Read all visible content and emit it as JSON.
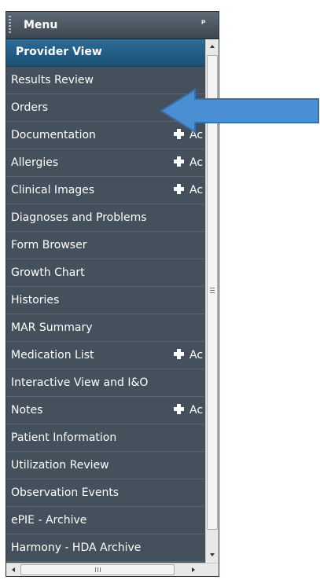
{
  "menu": {
    "title": "Menu",
    "pin_glyph": "ᵖ"
  },
  "section": {
    "label": "Provider View"
  },
  "items": [
    {
      "label": "Results Review",
      "add": ""
    },
    {
      "label": "Orders",
      "add": ""
    },
    {
      "label": "Documentation",
      "add": "Ac"
    },
    {
      "label": "Allergies",
      "add": "Ac"
    },
    {
      "label": "Clinical Images",
      "add": "Ac"
    },
    {
      "label": "Diagnoses and Problems",
      "add": ""
    },
    {
      "label": "Form Browser",
      "add": ""
    },
    {
      "label": "Growth Chart",
      "add": ""
    },
    {
      "label": "Histories",
      "add": ""
    },
    {
      "label": "MAR Summary",
      "add": ""
    },
    {
      "label": "Medication List",
      "add": "Ac"
    },
    {
      "label": "Interactive View and I&O",
      "add": ""
    },
    {
      "label": "Notes",
      "add": "Ac"
    },
    {
      "label": "Patient Information",
      "add": ""
    },
    {
      "label": "Utilization Review",
      "add": ""
    },
    {
      "label": "Observation Events",
      "add": ""
    },
    {
      "label": "ePIE - Archive",
      "add": ""
    },
    {
      "label": "Harmony - HDA Archive",
      "add": ""
    }
  ],
  "colors": {
    "panel_bg": "#44505b",
    "section_header": "#1f587f",
    "annotation_arrow": "#4a8fd4"
  },
  "icons": {
    "pin": "pin-icon",
    "add": "plus-icon",
    "annotation": "arrow-left-icon"
  }
}
